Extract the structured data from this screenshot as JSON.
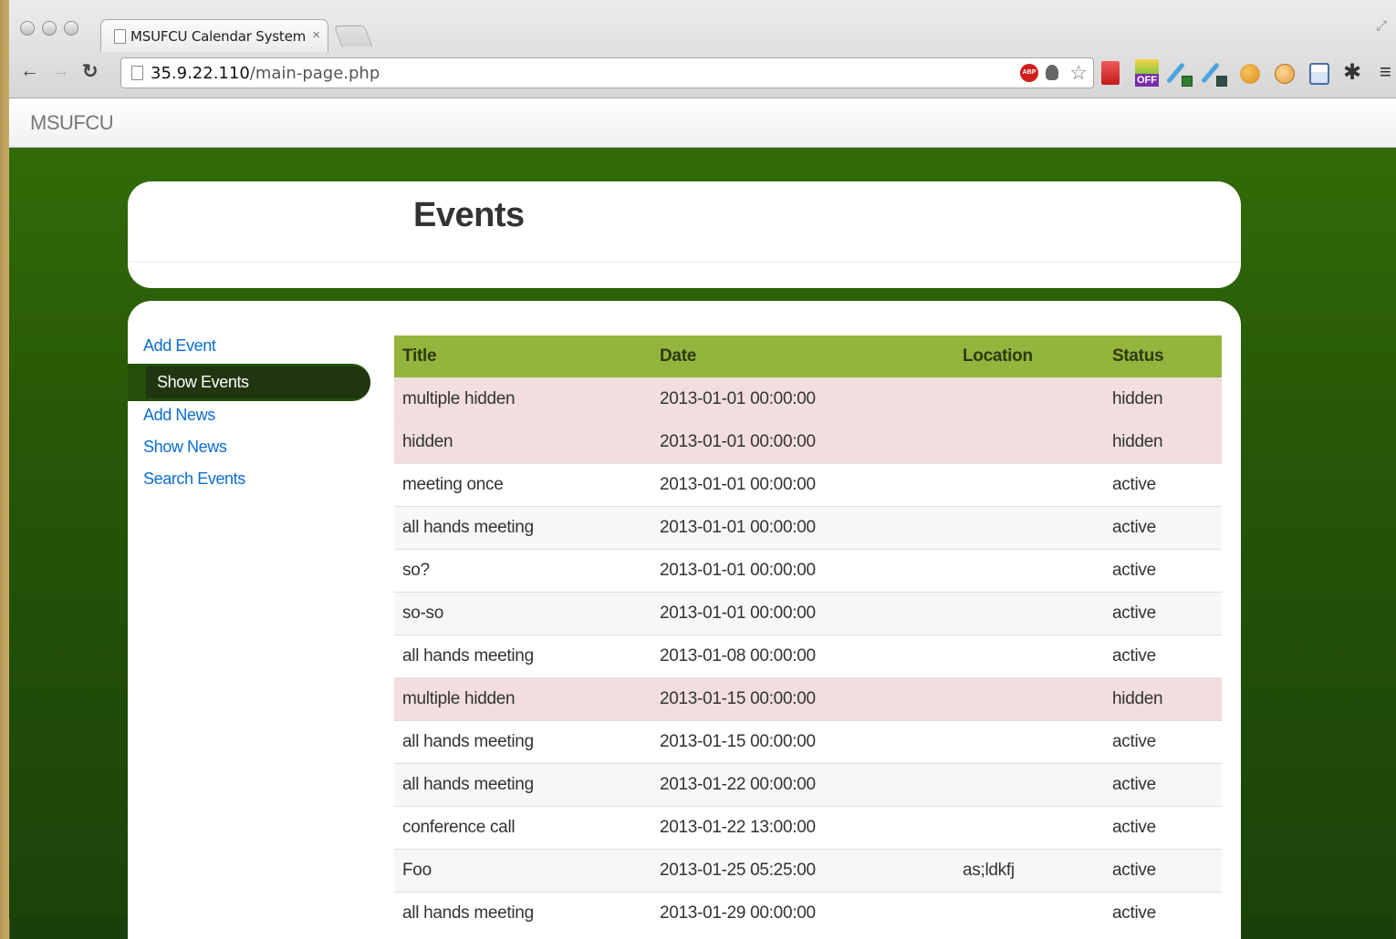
{
  "browser": {
    "tab_title": "MSUFCU Calendar System",
    "tab_close": "×",
    "url_host": "35.9.22.110",
    "url_path": "/main-page.php",
    "ext_off_label": "OFF",
    "abp_label": "ABP"
  },
  "site": {
    "brand": "MSUFCU",
    "page_title": "Events"
  },
  "sidebar": {
    "items": [
      {
        "label": "Add Event"
      },
      {
        "label": "Show Events"
      },
      {
        "label": "Add News"
      },
      {
        "label": "Show News"
      },
      {
        "label": "Search Events"
      }
    ]
  },
  "table": {
    "headers": [
      "Title",
      "Date",
      "Location",
      "Status"
    ],
    "rows": [
      {
        "title": "multiple hidden",
        "date": "2013-01-01 00:00:00",
        "location": "",
        "status": "hidden"
      },
      {
        "title": "hidden",
        "date": "2013-01-01 00:00:00",
        "location": "",
        "status": "hidden"
      },
      {
        "title": "meeting once",
        "date": "2013-01-01 00:00:00",
        "location": "",
        "status": "active"
      },
      {
        "title": "all hands meeting",
        "date": "2013-01-01 00:00:00",
        "location": "",
        "status": "active"
      },
      {
        "title": "so?",
        "date": "2013-01-01 00:00:00",
        "location": "",
        "status": "active"
      },
      {
        "title": "so-so",
        "date": "2013-01-01 00:00:00",
        "location": "",
        "status": "active"
      },
      {
        "title": "all hands meeting",
        "date": "2013-01-08 00:00:00",
        "location": "",
        "status": "active"
      },
      {
        "title": "multiple hidden",
        "date": "2013-01-15 00:00:00",
        "location": "",
        "status": "hidden"
      },
      {
        "title": "all hands meeting",
        "date": "2013-01-15 00:00:00",
        "location": "",
        "status": "active"
      },
      {
        "title": "all hands meeting",
        "date": "2013-01-22 00:00:00",
        "location": "",
        "status": "active"
      },
      {
        "title": "conference call",
        "date": "2013-01-22 13:00:00",
        "location": "",
        "status": "active"
      },
      {
        "title": "Foo",
        "date": "2013-01-25 05:25:00",
        "location": "as;ldkfj",
        "status": "active"
      },
      {
        "title": "all hands meeting",
        "date": "2013-01-29 00:00:00",
        "location": "",
        "status": "active"
      }
    ]
  },
  "colors": {
    "accent_green": "#93b43d",
    "hidden_row": "#f2dede",
    "link": "#0a6cd1"
  }
}
